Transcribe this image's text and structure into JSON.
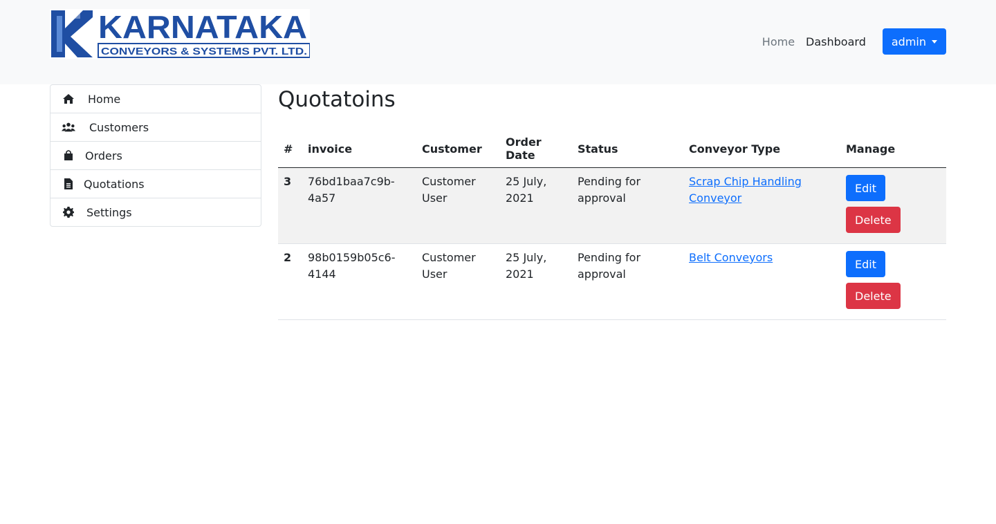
{
  "brand": {
    "logo_line1": "KARNATAKA",
    "logo_line2": "CONVEYORS & SYSTEMS PVT. LTD.",
    "colors": {
      "blue": "#1f4ea3",
      "light_blue": "#2f6fd0"
    }
  },
  "nav": {
    "home": "Home",
    "dashboard": "Dashboard",
    "user_menu": "admin"
  },
  "sidebar": {
    "items": [
      {
        "label": "Home",
        "icon": "home-icon"
      },
      {
        "label": "Customers",
        "icon": "users-icon"
      },
      {
        "label": "Orders",
        "icon": "shopping-bag-icon"
      },
      {
        "label": "Quotations",
        "icon": "file-icon"
      },
      {
        "label": "Settings",
        "icon": "gear-icon"
      }
    ]
  },
  "main": {
    "title": "Quotatoins",
    "table": {
      "headers": [
        "#",
        "invoice",
        "Customer",
        "Order Date",
        "Status",
        "Conveyor Type",
        "Manage"
      ],
      "rows": [
        {
          "num": "3",
          "invoice": "76bd1baa7c9b-4a57",
          "customer": "Customer User",
          "date": "25 July, 2021",
          "status": "Pending for approval",
          "conveyor": "Scrap Chip Handling Conveyor",
          "edit": "Edit",
          "delete": "Delete"
        },
        {
          "num": "2",
          "invoice": "98b0159b05c6-4144",
          "customer": "Customer User",
          "date": "25 July, 2021",
          "status": "Pending for approval",
          "conveyor": "Belt Conveyors",
          "edit": "Edit",
          "delete": "Delete"
        }
      ]
    }
  }
}
